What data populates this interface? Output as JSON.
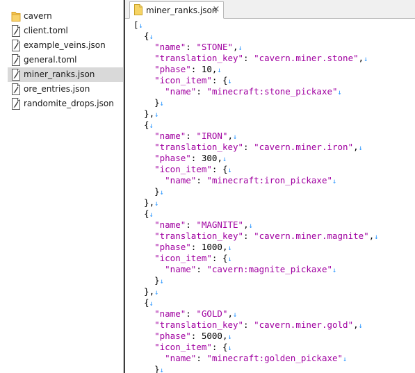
{
  "sidebar": {
    "items": [
      {
        "label": "cavern",
        "icon": "folder-icon",
        "selected": false
      },
      {
        "label": "client.toml",
        "icon": "file-icon",
        "selected": false
      },
      {
        "label": "example_veins.json",
        "icon": "file-icon",
        "selected": false
      },
      {
        "label": "general.toml",
        "icon": "file-icon",
        "selected": false
      },
      {
        "label": "miner_ranks.json",
        "icon": "file-icon",
        "selected": true
      },
      {
        "label": "ore_entries.json",
        "icon": "file-icon",
        "selected": false
      },
      {
        "label": "randomite_drops.json",
        "icon": "file-icon",
        "selected": false
      }
    ]
  },
  "editor": {
    "tab": {
      "label": "miner_ranks.json",
      "close_glyph": "×"
    },
    "eol_marker": "↓",
    "lines": [
      [
        [
          "punc",
          "["
        ]
      ],
      [
        [
          "punc",
          "  {"
        ]
      ],
      [
        [
          "punc",
          "    "
        ],
        [
          "key",
          "\"name\""
        ],
        [
          "punc",
          ": "
        ],
        [
          "str",
          "\"STONE\""
        ],
        [
          "punc",
          ","
        ]
      ],
      [
        [
          "punc",
          "    "
        ],
        [
          "key",
          "\"translation_key\""
        ],
        [
          "punc",
          ": "
        ],
        [
          "str",
          "\"cavern.miner.stone\""
        ],
        [
          "punc",
          ","
        ]
      ],
      [
        [
          "punc",
          "    "
        ],
        [
          "key",
          "\"phase\""
        ],
        [
          "punc",
          ": "
        ],
        [
          "num",
          "10"
        ],
        [
          "punc",
          ","
        ]
      ],
      [
        [
          "punc",
          "    "
        ],
        [
          "key",
          "\"icon_item\""
        ],
        [
          "punc",
          ": {"
        ]
      ],
      [
        [
          "punc",
          "      "
        ],
        [
          "key",
          "\"name\""
        ],
        [
          "punc",
          ": "
        ],
        [
          "str",
          "\"minecraft:stone_pickaxe\""
        ]
      ],
      [
        [
          "punc",
          "    }"
        ]
      ],
      [
        [
          "punc",
          "  },"
        ]
      ],
      [
        [
          "punc",
          "  {"
        ]
      ],
      [
        [
          "punc",
          "    "
        ],
        [
          "key",
          "\"name\""
        ],
        [
          "punc",
          ": "
        ],
        [
          "str",
          "\"IRON\""
        ],
        [
          "punc",
          ","
        ]
      ],
      [
        [
          "punc",
          "    "
        ],
        [
          "key",
          "\"translation_key\""
        ],
        [
          "punc",
          ": "
        ],
        [
          "str",
          "\"cavern.miner.iron\""
        ],
        [
          "punc",
          ","
        ]
      ],
      [
        [
          "punc",
          "    "
        ],
        [
          "key",
          "\"phase\""
        ],
        [
          "punc",
          ": "
        ],
        [
          "num",
          "300"
        ],
        [
          "punc",
          ","
        ]
      ],
      [
        [
          "punc",
          "    "
        ],
        [
          "key",
          "\"icon_item\""
        ],
        [
          "punc",
          ": {"
        ]
      ],
      [
        [
          "punc",
          "      "
        ],
        [
          "key",
          "\"name\""
        ],
        [
          "punc",
          ": "
        ],
        [
          "str",
          "\"minecraft:iron_pickaxe\""
        ]
      ],
      [
        [
          "punc",
          "    }"
        ]
      ],
      [
        [
          "punc",
          "  },"
        ]
      ],
      [
        [
          "punc",
          "  {"
        ]
      ],
      [
        [
          "punc",
          "    "
        ],
        [
          "key",
          "\"name\""
        ],
        [
          "punc",
          ": "
        ],
        [
          "str",
          "\"MAGNITE\""
        ],
        [
          "punc",
          ","
        ]
      ],
      [
        [
          "punc",
          "    "
        ],
        [
          "key",
          "\"translation_key\""
        ],
        [
          "punc",
          ": "
        ],
        [
          "str",
          "\"cavern.miner.magnite\""
        ],
        [
          "punc",
          ","
        ]
      ],
      [
        [
          "punc",
          "    "
        ],
        [
          "key",
          "\"phase\""
        ],
        [
          "punc",
          ": "
        ],
        [
          "num",
          "1000"
        ],
        [
          "punc",
          ","
        ]
      ],
      [
        [
          "punc",
          "    "
        ],
        [
          "key",
          "\"icon_item\""
        ],
        [
          "punc",
          ": {"
        ]
      ],
      [
        [
          "punc",
          "      "
        ],
        [
          "key",
          "\"name\""
        ],
        [
          "punc",
          ": "
        ],
        [
          "str",
          "\"cavern:magnite_pickaxe\""
        ]
      ],
      [
        [
          "punc",
          "    }"
        ]
      ],
      [
        [
          "punc",
          "  },"
        ]
      ],
      [
        [
          "punc",
          "  {"
        ]
      ],
      [
        [
          "punc",
          "    "
        ],
        [
          "key",
          "\"name\""
        ],
        [
          "punc",
          ": "
        ],
        [
          "str",
          "\"GOLD\""
        ],
        [
          "punc",
          ","
        ]
      ],
      [
        [
          "punc",
          "    "
        ],
        [
          "key",
          "\"translation_key\""
        ],
        [
          "punc",
          ": "
        ],
        [
          "str",
          "\"cavern.miner.gold\""
        ],
        [
          "punc",
          ","
        ]
      ],
      [
        [
          "punc",
          "    "
        ],
        [
          "key",
          "\"phase\""
        ],
        [
          "punc",
          ": "
        ],
        [
          "num",
          "5000"
        ],
        [
          "punc",
          ","
        ]
      ],
      [
        [
          "punc",
          "    "
        ],
        [
          "key",
          "\"icon_item\""
        ],
        [
          "punc",
          ": {"
        ]
      ],
      [
        [
          "punc",
          "      "
        ],
        [
          "key",
          "\"name\""
        ],
        [
          "punc",
          ": "
        ],
        [
          "str",
          "\"minecraft:golden_pickaxe\""
        ]
      ],
      [
        [
          "punc",
          "    }"
        ]
      ]
    ]
  },
  "colors": {
    "key_string": "#a000a0",
    "eol_marker": "#1e90ff",
    "selection": "#d9d9d9"
  }
}
